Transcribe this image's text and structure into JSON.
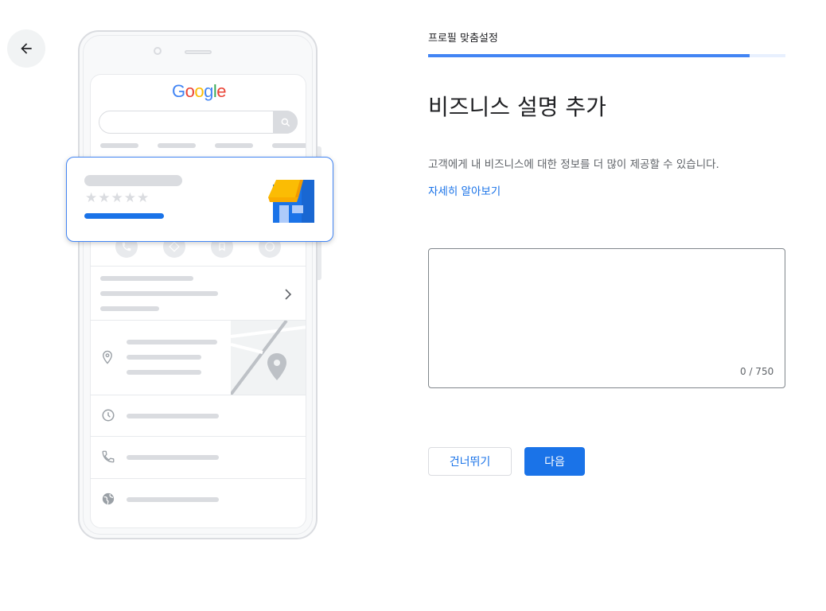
{
  "nav": {
    "back_icon": "arrow-back-icon"
  },
  "illustration": {
    "logo_letters": [
      "G",
      "o",
      "o",
      "g",
      "l",
      "e"
    ],
    "stars": "★★★★★",
    "icons": [
      "phone-icon",
      "directions-icon",
      "bookmark-icon",
      "website-icon",
      "location-pin-icon",
      "clock-icon",
      "phone-icon",
      "globe-icon",
      "storefront-icon",
      "chevron-right-icon",
      "search-icon"
    ]
  },
  "header": {
    "step_label": "프로필 맞춤설정",
    "progress_percent": 90
  },
  "main": {
    "title": "비즈니스 설명 추가",
    "description": "고객에게 내 비즈니스에 대한 정보를 더 많이 제공할 수 있습니다.",
    "learn_more": "자세히 알아보기",
    "textarea_value": "",
    "char_count": "0 / 750"
  },
  "actions": {
    "skip_label": "건너뛰기",
    "next_label": "다음"
  },
  "colors": {
    "accent": "#1a73e8",
    "progress_fill": "#4285f4",
    "progress_track": "#e8f0fe",
    "placeholder_gray": "#dadce0"
  }
}
